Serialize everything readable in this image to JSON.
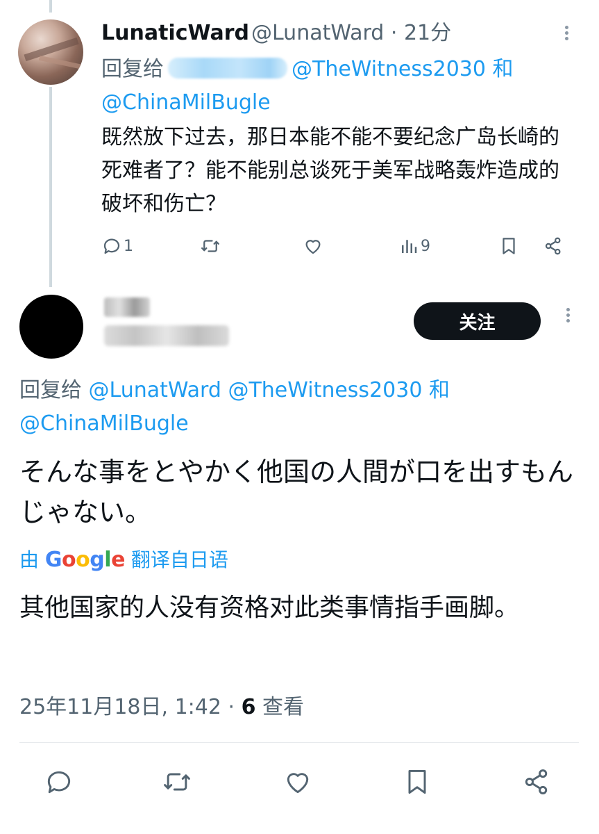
{
  "tweet1": {
    "display_name": "LunaticWard",
    "handle_time": "@LunatWard · 21分",
    "reply_prefix": "回复给",
    "reply_to": [
      "@TheWitness2030",
      "和",
      "@ChinaMilBugle"
    ],
    "body": "既然放下过去，那日本能不能不要纪念广岛长崎的死难者了？能不能别总谈死于美军战略轰炸造成的破坏和伤亡？",
    "replies": "1",
    "views": "9"
  },
  "tweet2": {
    "follow_label": "关注",
    "reply_prefix": "回复给",
    "reply_to": [
      "@LunatWard",
      "@TheWitness2030",
      "和",
      "@ChinaMilBugle"
    ],
    "body": "そんな事をとやかく他国の人間が口を出すもんじゃない。",
    "translated_prefix": "由",
    "translated_brand": "Google",
    "translated_suffix": "翻译自日语",
    "translation": "其他国家的人没有资格对此类事情指手画脚。",
    "timestamp": "25年11月18日, 1:42 · ",
    "views_count": "6",
    "views_label": " 查看"
  },
  "icons": [
    "more-icon",
    "reply-icon",
    "retweet-icon",
    "like-icon",
    "views-icon",
    "bookmark-icon",
    "share-icon"
  ],
  "colors": {
    "link": "#1d9bf0",
    "text": "#0f1419",
    "muted": "#536471",
    "follow_bg": "#0f1419"
  }
}
